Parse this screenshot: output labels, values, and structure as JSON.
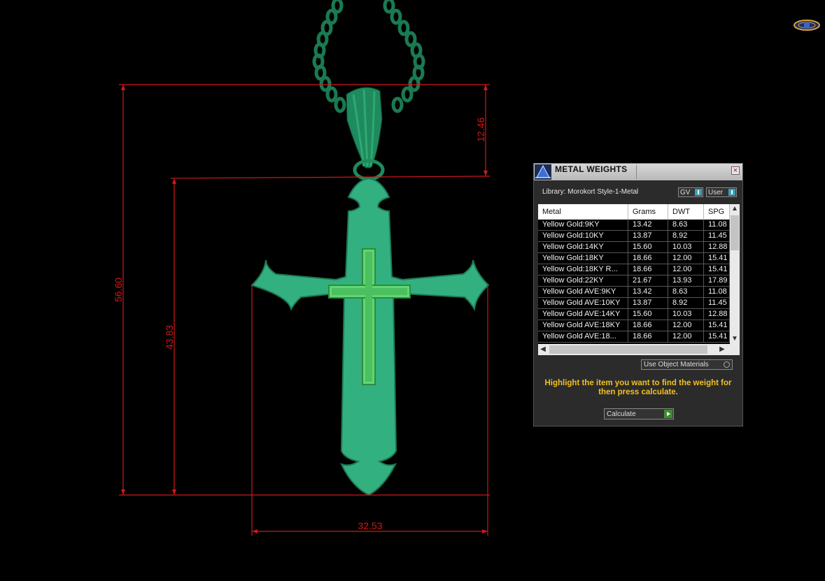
{
  "dimensions": {
    "overall_height": "56.60",
    "body_height": "43.83",
    "bail_height": "12.46",
    "width": "32.53"
  },
  "panel": {
    "title": "METAL WEIGHTS",
    "close_icon": "close-icon",
    "library_label": "Library: Morokort Style-1-Metal",
    "gv_toggle_label": "GV",
    "user_toggle_label": "User",
    "columns": [
      "Metal",
      "Grams",
      "DWT",
      "SPG"
    ],
    "rows": [
      {
        "metal": "Yellow Gold:9KY",
        "grams": "13.42",
        "dwt": "8.63",
        "spg": "11.08"
      },
      {
        "metal": "Yellow Gold:10KY",
        "grams": "13.87",
        "dwt": "8.92",
        "spg": "11.45"
      },
      {
        "metal": "Yellow Gold:14KY",
        "grams": "15.60",
        "dwt": "10.03",
        "spg": "12.88"
      },
      {
        "metal": "Yellow Gold:18KY",
        "grams": "18.66",
        "dwt": "12.00",
        "spg": "15.41"
      },
      {
        "metal": "Yellow Gold:18KY R...",
        "grams": "18.66",
        "dwt": "12.00",
        "spg": "15.41"
      },
      {
        "metal": "Yellow Gold:22KY",
        "grams": "21.67",
        "dwt": "13.93",
        "spg": "17.89"
      },
      {
        "metal": "Yellow Gold AVE:9KY",
        "grams": "13.42",
        "dwt": "8.63",
        "spg": "11.08"
      },
      {
        "metal": "Yellow Gold AVE:10KY",
        "grams": "13.87",
        "dwt": "8.92",
        "spg": "11.45"
      },
      {
        "metal": "Yellow Gold AVE:14KY",
        "grams": "15.60",
        "dwt": "10.03",
        "spg": "12.88"
      },
      {
        "metal": "Yellow Gold AVE:18KY",
        "grams": "18.66",
        "dwt": "12.00",
        "spg": "15.41"
      },
      {
        "metal": "Yellow Gold AVE:18...",
        "grams": "18.66",
        "dwt": "12.00",
        "spg": "15.41"
      }
    ],
    "use_object_materials_label": "Use Object Materials",
    "instruction": "Highlight the item you want to find the weight for then press calculate.",
    "calculate_label": "Calculate"
  },
  "colors": {
    "dimension_line": "#d01818",
    "pendant": "#33b080",
    "pendant_dark": "#1d7a55",
    "inlay": "#5fd870",
    "instruction_text": "#f0c020"
  }
}
